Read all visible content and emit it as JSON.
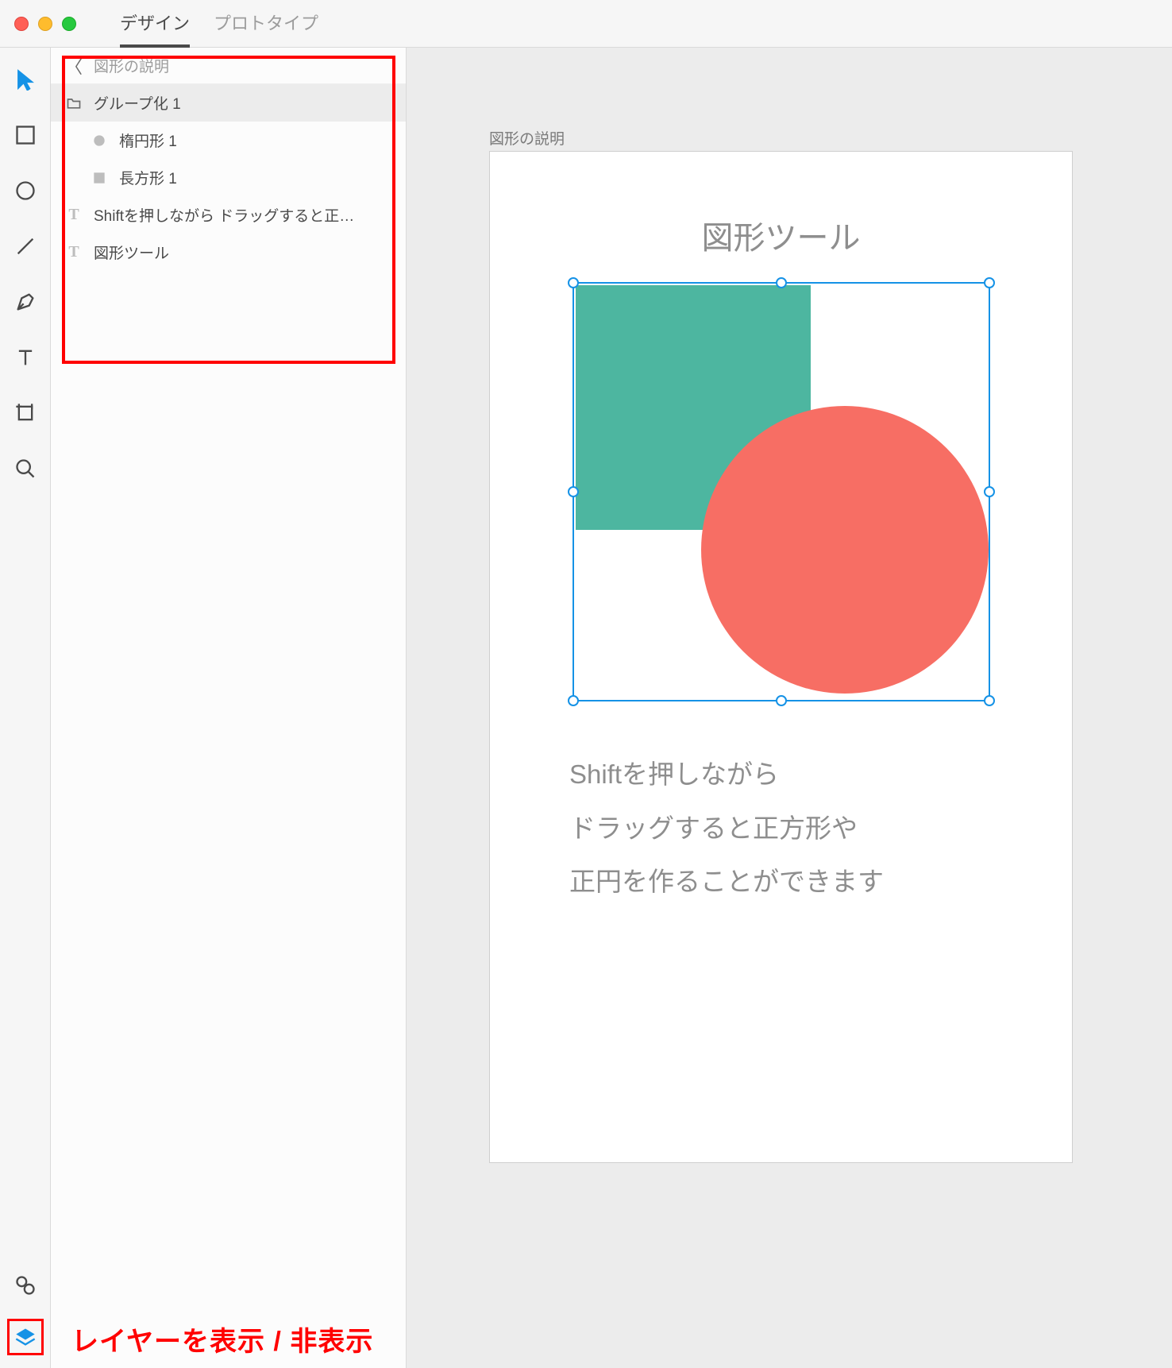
{
  "tabs": {
    "design": "デザイン",
    "prototype": "プロトタイプ"
  },
  "layers": {
    "header_title": "図形の説明",
    "items": [
      {
        "type": "group",
        "label": "グループ化 1",
        "selected": true
      },
      {
        "type": "ellipse",
        "label": "楕円形 1",
        "indent": true
      },
      {
        "type": "rect",
        "label": "長方形 1",
        "indent": true
      },
      {
        "type": "text",
        "label": "Shiftを押しながら ドラッグすると正…"
      },
      {
        "type": "text",
        "label": "図形ツール"
      }
    ]
  },
  "artboard": {
    "label": "図形の説明",
    "title": "図形ツール",
    "body": "Shiftを押しながら\nドラッグすると正方形や\n正円を作ることができます"
  },
  "colors": {
    "square": "#4db6a0",
    "circle": "#f76e64",
    "selection": "#1592e6",
    "highlight": "#ff0000"
  },
  "annotation": "レイヤーを表示 / 非表示"
}
